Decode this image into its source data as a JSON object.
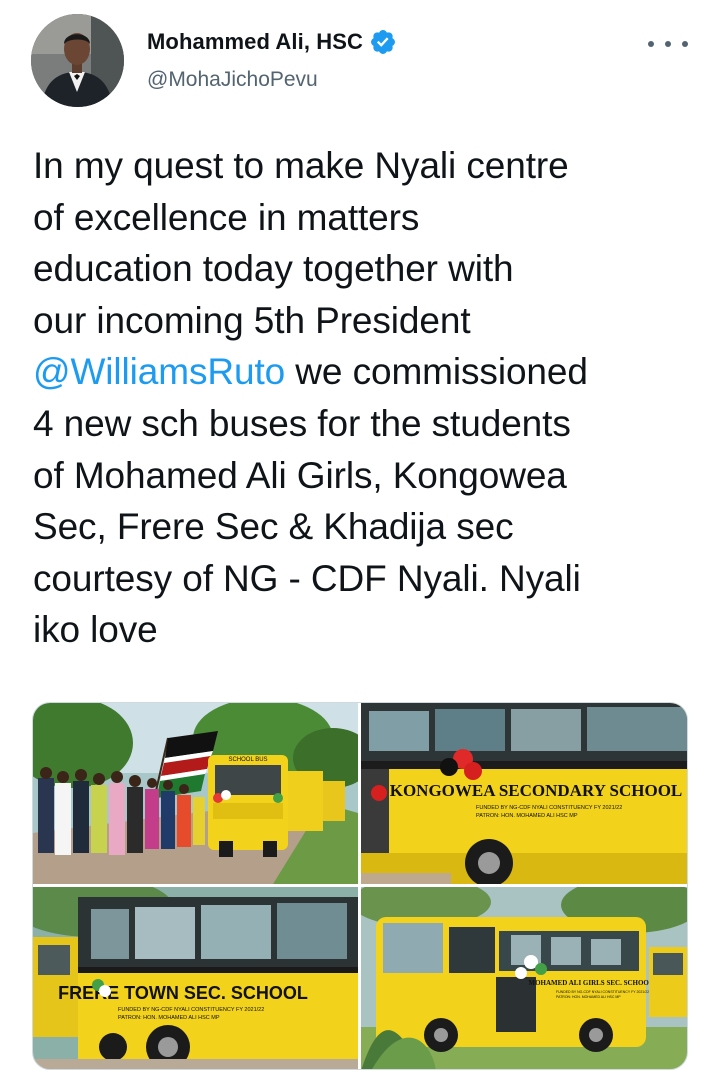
{
  "author": {
    "display_name": "Mohammed Ali, HSC",
    "handle": "@MohaJichoPevu",
    "verified": true,
    "avatar_icon": "profile-photo"
  },
  "tweet": {
    "lines": [
      {
        "text": "In my quest to make Nyali centre"
      },
      {
        "text": "of excellence in matters"
      },
      {
        "text": "education today together with"
      },
      {
        "text": "our incoming 5th President"
      },
      {
        "mention": "@WilliamsRuto",
        "text": " we commissioned"
      },
      {
        "text": "4 new sch buses for the students"
      },
      {
        "text": "of Mohamed Ali Girls, Kongowea"
      },
      {
        "text": "Sec, Frere Sec & Khadija sec"
      },
      {
        "text": "courtesy of NG - CDF Nyali. Nyali"
      },
      {
        "text": "iko love"
      }
    ]
  },
  "media": {
    "photos": [
      {
        "name": "photo-bus-line-flag",
        "bus_sign": "SCHOOL BUS"
      },
      {
        "name": "photo-kongowea-bus",
        "school_name": "KONGOWEA SECONDARY SCHOOL",
        "fine_print": [
          "FUNDED BY NG-CDF NYALI CONSTITUENCY FY 2021/22",
          "PATRON: HON. MOHAMED ALI HSC MP"
        ]
      },
      {
        "name": "photo-frere-town-bus",
        "school_name": "FRERE TOWN SEC. SCHOOL",
        "fine_print": [
          "FUNDED BY NG-CDF NYALI CONSTITUENCY FY 2021/22",
          "PATRON: HON. MOHAMED ALI HSC MP"
        ]
      },
      {
        "name": "photo-mohamed-ali-girls-bus",
        "school_name": "MOHAMED ALI GIRLS SEC. SCHOOL",
        "fine_print": [
          "FUNDED BY NG-CDF NYALI CONSTITUENCY FY 2021/22",
          "PATRON: HON. MOHAMED ALI HSC MP"
        ]
      }
    ]
  },
  "colors": {
    "link": "#1d9bf0",
    "text": "#0f1419",
    "secondary": "#536471",
    "bus_yellow": "#f2d21b"
  },
  "icons": {
    "verified": "verified-badge-icon",
    "more": "more-options-icon"
  }
}
